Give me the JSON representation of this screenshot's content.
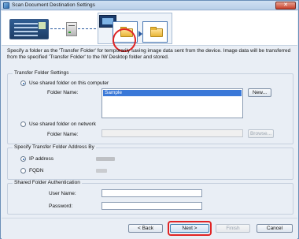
{
  "window": {
    "title": "Scan Document Destination Settings",
    "close_symbol": "✕"
  },
  "description": "Specify a folder as the 'Transfer Folder' for temporarily saving image data sent from the device. Image data will be transferred from the specified 'Transfer Folder' to the IW Desktop folder and stored.",
  "transfer_folder": {
    "legend": "Transfer Folder Settings",
    "option_local": "Use shared folder on this computer",
    "folder_name_label": "Folder Name:",
    "folder_list_selected": "Sample",
    "new_button": "New...",
    "option_network": "Use shared folder on network",
    "network_folder_name_label": "Folder Name:",
    "browse_button": "Browse..."
  },
  "address": {
    "legend": "Specify Transfer Folder Address By",
    "option_ip": "IP address",
    "option_fqdn": "FQDN"
  },
  "auth": {
    "legend": "Shared Folder Authentication",
    "user_label": "User Name:",
    "password_label": "Password:"
  },
  "footer": {
    "back": "< Back",
    "next": "Next >",
    "finish": "Finish",
    "cancel": "Cancel"
  },
  "colors": {
    "highlight": "#e02424",
    "selection": "#3a78d8"
  }
}
